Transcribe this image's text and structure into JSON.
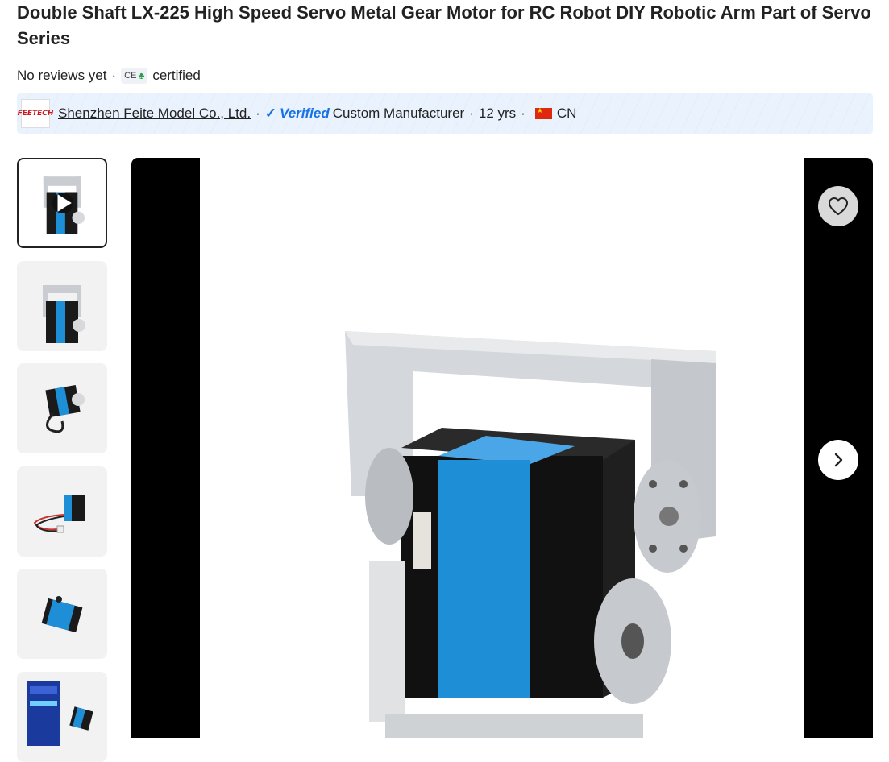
{
  "product": {
    "title": "Double Shaft LX-225 High Speed Servo Metal Gear Motor for RC Robot DIY Robotic Arm Part of Servo Series"
  },
  "reviews": {
    "text": "No reviews yet",
    "separator": "·",
    "cert_badge": "CE",
    "certified_label": "certified"
  },
  "supplier": {
    "logo_text": "FEETECH",
    "name": "Shenzhen Feite Model Co., Ltd.",
    "sep": "·",
    "verified_label": "Verified",
    "type": "Custom Manufacturer",
    "years": "12 yrs",
    "country": "CN"
  },
  "thumbnails": [
    {
      "name": "thumb-video",
      "video": true
    },
    {
      "name": "thumb-front",
      "video": false
    },
    {
      "name": "thumb-cable-side",
      "video": false
    },
    {
      "name": "thumb-cable-front",
      "video": false
    },
    {
      "name": "thumb-servo-only",
      "video": false
    },
    {
      "name": "thumb-package",
      "video": false
    }
  ],
  "colors": {
    "accent_blue": "#1672e6",
    "servo_blue": "#1e8fd6",
    "viewer_bg": "#000000"
  },
  "icons": {
    "favorite": "heart-icon",
    "next": "chevron-right-icon",
    "play": "play-icon"
  }
}
